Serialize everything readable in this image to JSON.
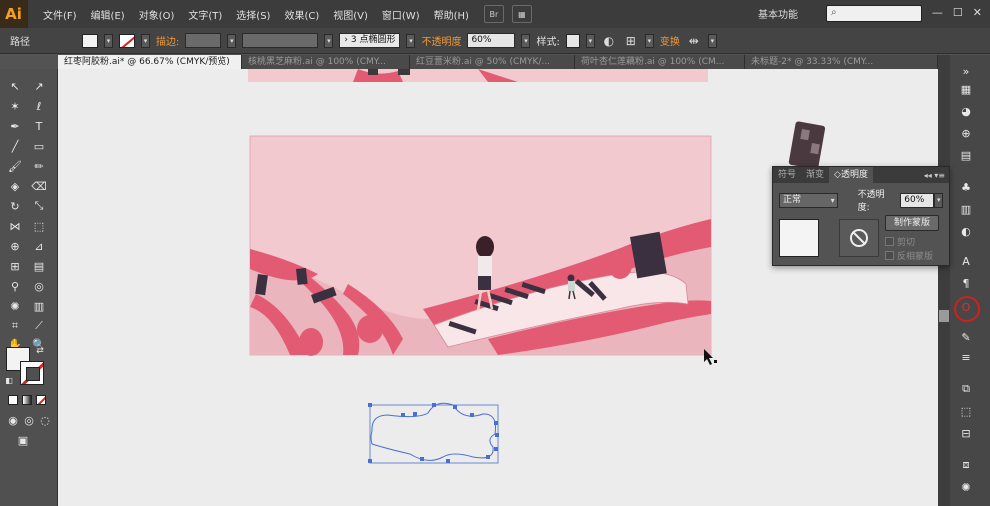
{
  "app": {
    "logo": "Ai",
    "menus": [
      "文件(F)",
      "编辑(E)",
      "对象(O)",
      "文字(T)",
      "选择(S)",
      "效果(C)",
      "视图(V)",
      "窗口(W)",
      "帮助(H)"
    ],
    "bridge_label": "Br",
    "workspace": "基本功能",
    "search_placeholder": "",
    "window_controls": [
      "—",
      "☐",
      "✕"
    ]
  },
  "control": {
    "selection_label": "路径",
    "stroke_label": "描边:",
    "stroke_style": "3 点椭圆形",
    "opacity_label": "不透明度",
    "opacity_value": "60%",
    "style_label": "样式:",
    "transform_label": "变换"
  },
  "tabs": [
    {
      "label": "红枣阿胶粉.ai* @ 66.67% (CMYK/预览)",
      "active": true
    },
    {
      "label": "核桃黑芝麻粉.ai @ 100% (CMY...",
      "active": false
    },
    {
      "label": "红豆薏米粉.ai @ 50% (CMYK/...",
      "active": false
    },
    {
      "label": "荷叶杏仁莲藕粉.ai @ 100% (CM...",
      "active": false
    },
    {
      "label": "未标题-2* @ 33.33% (CMY...",
      "active": false
    }
  ],
  "transparency_panel": {
    "tabs": [
      {
        "label": "符号",
        "active": false
      },
      {
        "label": "渐变",
        "active": false
      },
      {
        "label": "◇透明度",
        "active": true
      }
    ],
    "blend_mode": "正常",
    "opacity_label": "不透明度:",
    "opacity_value": "60%",
    "make_mask_label": "制作蒙版",
    "clip_label": "剪切",
    "invert_label": "反相蒙版"
  },
  "colors": {
    "accent_orange": "#f09a3a",
    "artboard_pink": "#f0c8cc",
    "wave_red": "#e0506a",
    "selection_blue": "#4a6fd0",
    "stroke_none_red": "#e02020"
  }
}
